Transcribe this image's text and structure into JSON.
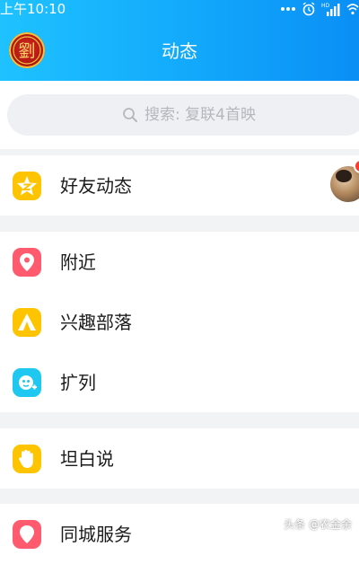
{
  "status_bar": {
    "time": "上午10:10",
    "icons": [
      "more-dots-icon",
      "alarm-icon",
      "hd-signal-icon",
      "wifi-icon"
    ],
    "hd_label": "HD"
  },
  "header": {
    "title": "动态",
    "avatar_icon": "profile-avatar-liu",
    "avatar_text": "劉"
  },
  "search": {
    "placeholder": "搜索: 复联4首映",
    "icon": "search-icon"
  },
  "menu": [
    {
      "label": "好友动态",
      "icon": "qzone-star-icon",
      "color": "#ffc400",
      "has_avatar": true,
      "badge": "red-dot"
    },
    {
      "label": "附近",
      "icon": "location-pin-icon",
      "color": "#ff5a6e"
    },
    {
      "label": "兴趣部落",
      "icon": "tent-icon",
      "color": "#ffc400"
    },
    {
      "label": "扩列",
      "icon": "planet-icon",
      "color": "#1ec8f0"
    },
    {
      "label": "坦白说",
      "icon": "hand-icon",
      "color": "#ffc400"
    },
    {
      "label": "同城服务",
      "icon": "city-service-icon",
      "color": "#ff5a6e"
    }
  ],
  "watermark": "头条 @农金余",
  "colors": {
    "header_start": "#1fc2ff",
    "header_end": "#0a8ff5",
    "background": "#f2f3f5"
  }
}
